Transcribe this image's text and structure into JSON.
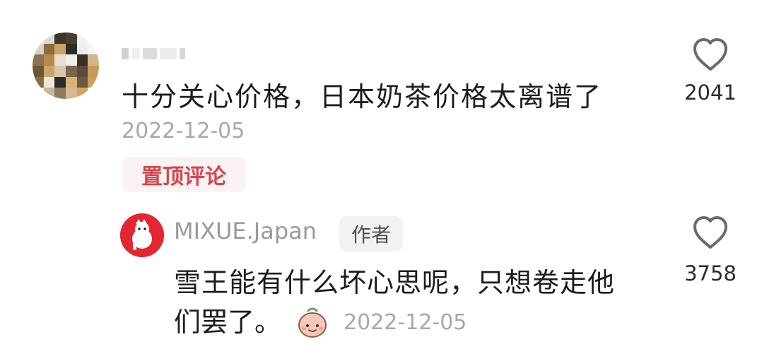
{
  "top_comment": {
    "text": "十分关心价格，日本奶茶价格太离谱了",
    "date": "2022-12-05",
    "pin_label": "置顶评论",
    "like_count": "2041"
  },
  "reply": {
    "username": "MIXUE.Japan",
    "author_badge": "作者",
    "text_line1": "雪王能有什么坏心思呢，只想卷走他",
    "text_line2": "们罢了。",
    "date": "2022-12-05",
    "like_count": "3758",
    "emoji": "peach-face-emoji"
  },
  "icons": {
    "like": "heart-outline-icon"
  },
  "colors": {
    "pin": "#d4464f",
    "brand_red": "#e3262f",
    "muted": "#a8a8a8"
  }
}
